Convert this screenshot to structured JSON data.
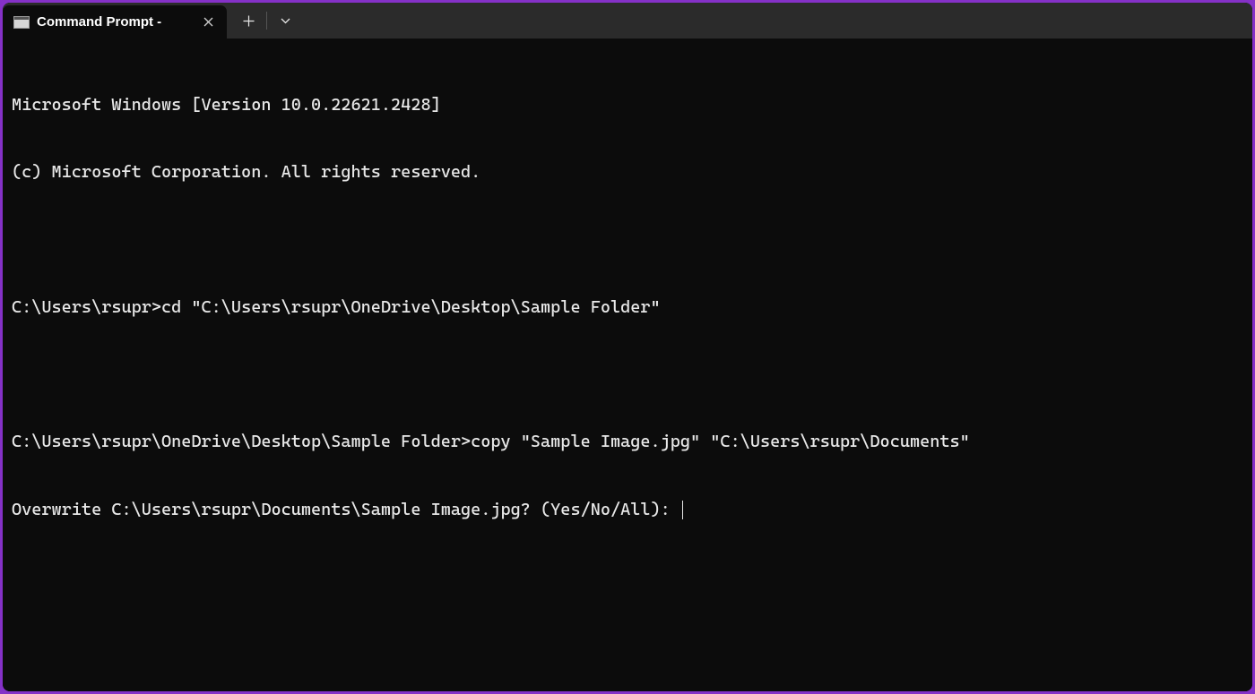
{
  "tab": {
    "title": "Command Prompt -"
  },
  "terminal": {
    "line1": "Microsoft Windows [Version 10.0.22621.2428]",
    "line2": "(c) Microsoft Corporation. All rights reserved.",
    "line3_prompt": "C:\\Users\\rsupr>",
    "line3_cmd": "cd \"C:\\Users\\rsupr\\OneDrive\\Desktop\\Sample Folder\"",
    "line4_prompt": "C:\\Users\\rsupr\\OneDrive\\Desktop\\Sample Folder>",
    "line4_cmd": "copy \"Sample Image.jpg\" \"C:\\Users\\rsupr\\Documents\"",
    "line5": "Overwrite C:\\Users\\rsupr\\Documents\\Sample Image.jpg? (Yes/No/All): "
  }
}
